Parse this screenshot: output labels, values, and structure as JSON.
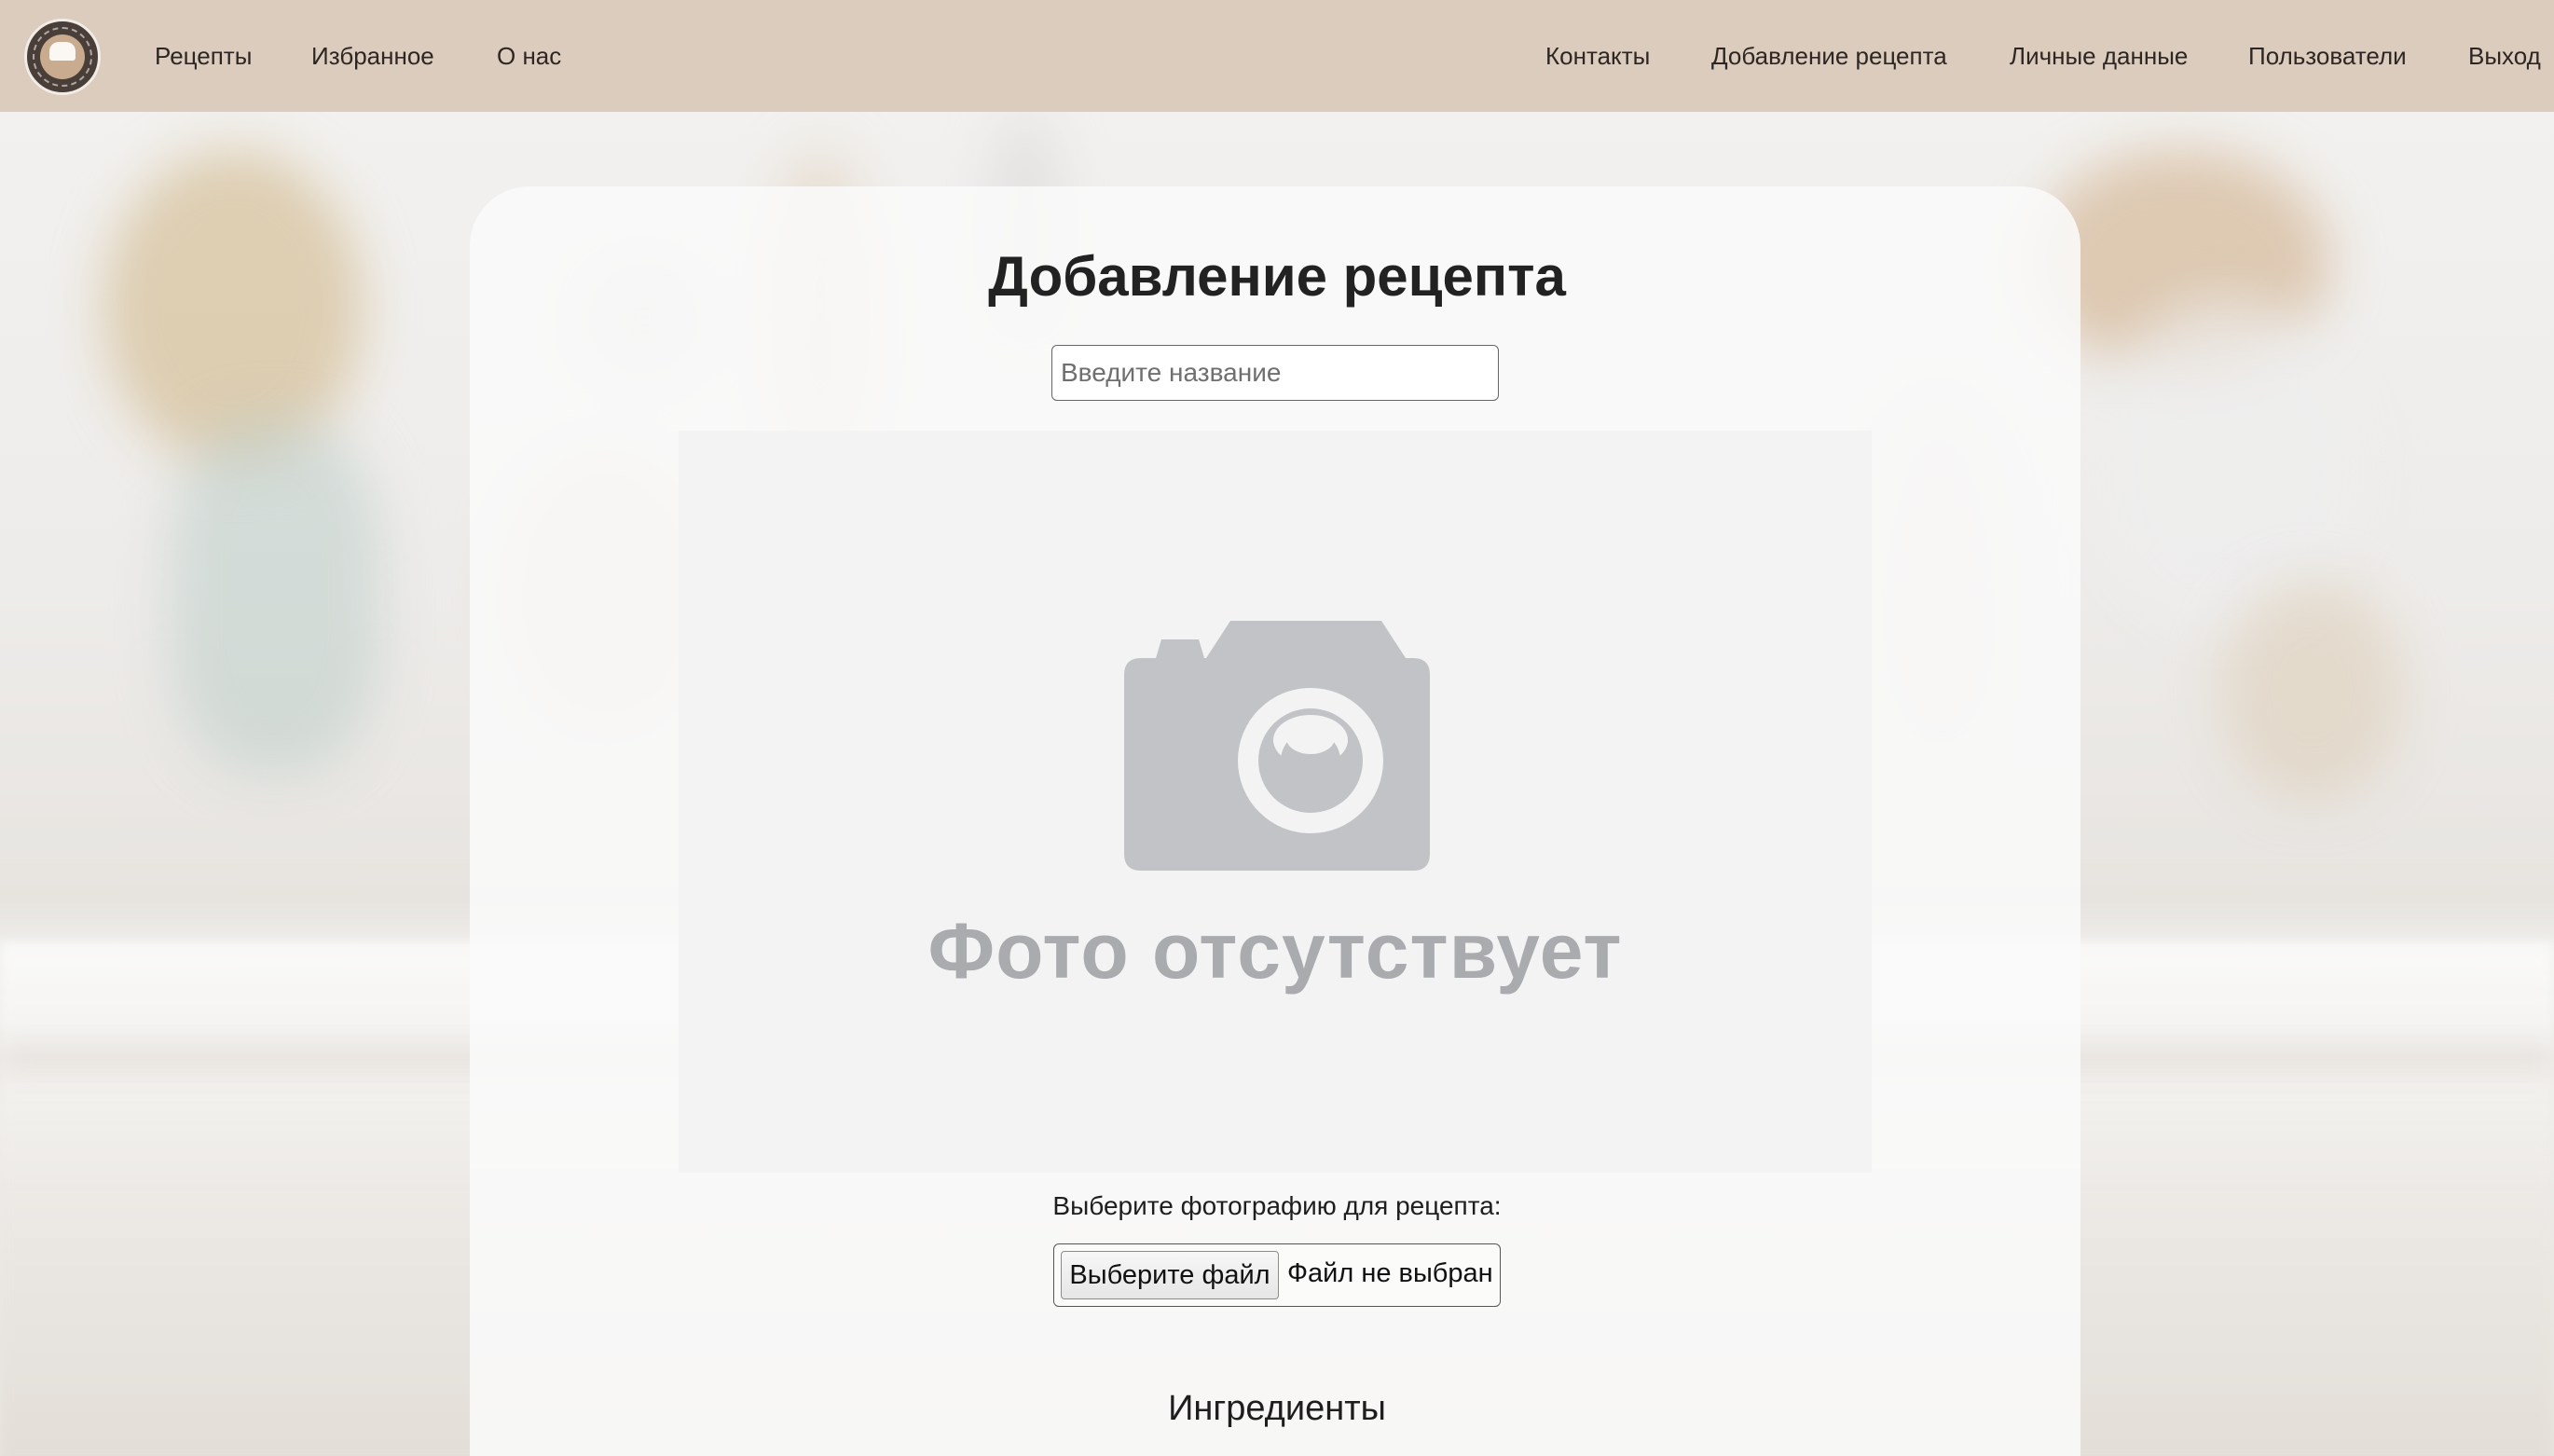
{
  "navbar": {
    "logo_alt": "EASY2COOK",
    "left_links": [
      "Рецепты",
      "Избранное",
      "О нас"
    ],
    "right_links": [
      "Контакты",
      "Добавление рецепта",
      "Личные данные",
      "Пользователи",
      "Выход"
    ]
  },
  "form": {
    "title": "Добавление рецепта",
    "name_placeholder": "Введите название",
    "name_value": "",
    "photo_placeholder_text": "Фото отсутствует",
    "photo_label": "Выберите фотографию для рецепта:",
    "file_button_label": "Выберите файл",
    "file_status": "Файл не выбран",
    "ingredients_heading": "Ингредиенты"
  },
  "colors": {
    "navbar_bg": "#dbccbe",
    "camera_icon": "#c1c3c6",
    "placeholder_text": "#a9abae"
  }
}
